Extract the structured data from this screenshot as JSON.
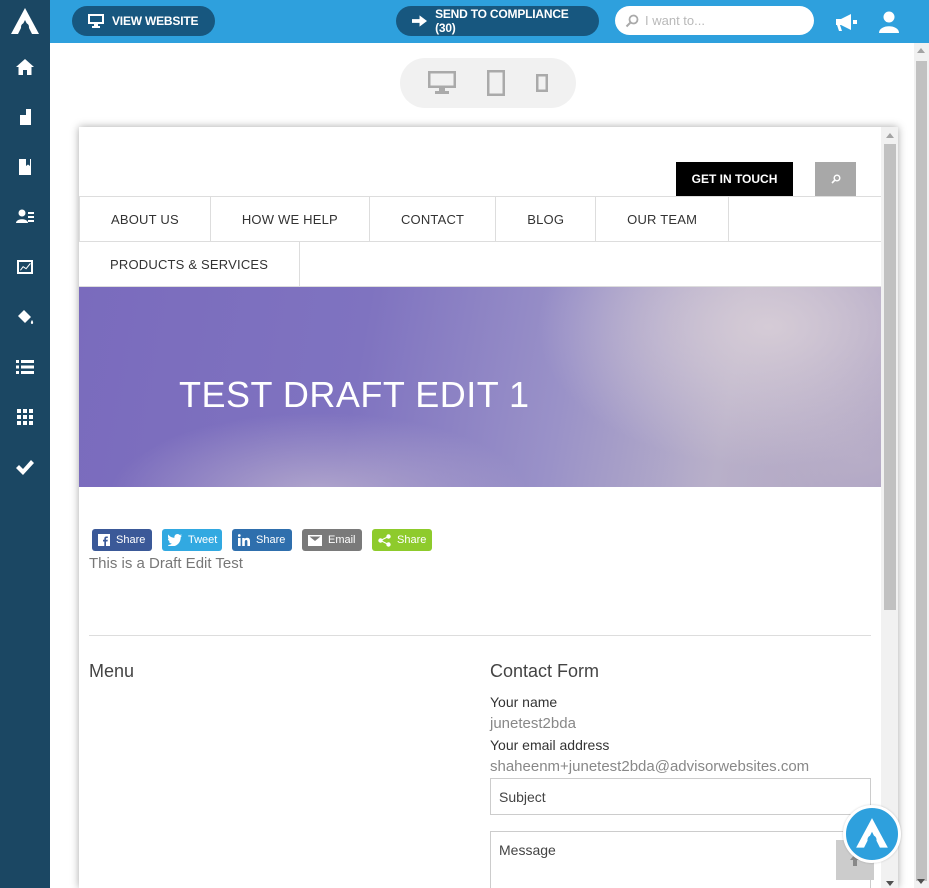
{
  "sidebar": {
    "items": [
      {
        "name": "home"
      },
      {
        "name": "pages"
      },
      {
        "name": "content"
      },
      {
        "name": "contacts"
      },
      {
        "name": "analytics"
      },
      {
        "name": "design"
      },
      {
        "name": "lists"
      },
      {
        "name": "apps"
      },
      {
        "name": "compliance"
      }
    ]
  },
  "topbar": {
    "view_website_label": "VIEW WEBSITE",
    "send_compliance_label": "SEND TO COMPLIANCE (30)",
    "search_placeholder": "I want to..."
  },
  "site": {
    "get_in_touch_label": "GET IN TOUCH",
    "nav": [
      "ABOUT US",
      "HOW WE HELP",
      "CONTACT",
      "BLOG",
      "OUR TEAM",
      "PRODUCTS & SERVICES"
    ],
    "hero_title": "TEST DRAFT EDIT 1",
    "shares": [
      {
        "label": "Share",
        "icon": "facebook-icon",
        "color": "#3b5998"
      },
      {
        "label": "Tweet",
        "icon": "twitter-icon",
        "color": "#32a9e1"
      },
      {
        "label": "Share",
        "icon": "linkedin-icon",
        "color": "#2f6fad"
      },
      {
        "label": "Email",
        "icon": "email-icon",
        "color": "#7a7a7a"
      },
      {
        "label": "Share",
        "icon": "share-icon",
        "color": "#8ecb2c"
      }
    ],
    "body_text": "This is a Draft Edit Test",
    "menu_title": "Menu",
    "contact_form": {
      "title": "Contact Form",
      "name_label": "Your name",
      "name_value": "junetest2bda",
      "email_label": "Your email address",
      "email_value": "shaheenm+junetest2bda@advisorwebsites.com",
      "subject_placeholder": "Subject",
      "message_placeholder": "Message"
    }
  },
  "colors": {
    "sidebar": "#1b4763",
    "topbar": "#2ea0dd",
    "pill": "#17577f"
  }
}
